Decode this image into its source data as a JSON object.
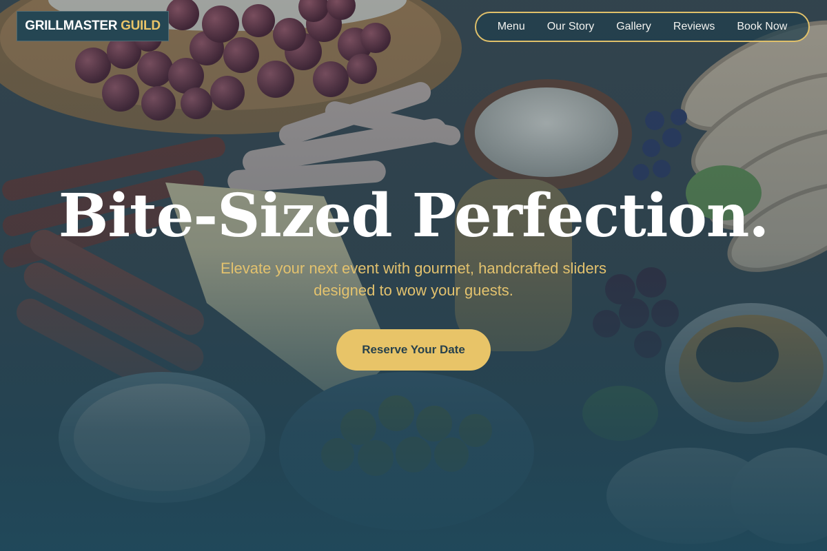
{
  "brand": {
    "name_part1": "GRILLMASTER",
    "name_part2": "GUILD"
  },
  "nav": {
    "items": [
      {
        "label": "Menu"
      },
      {
        "label": "Our Story"
      },
      {
        "label": "Gallery"
      },
      {
        "label": "Reviews"
      },
      {
        "label": "Book Now"
      }
    ]
  },
  "hero": {
    "headline": "Bite-Sized Perfection.",
    "subheadline_line1": "Elevate your next event with gourmet, handcrafted sliders",
    "subheadline_line2": "designed to wow your guests.",
    "cta_label": "Reserve Your Date",
    "image_subject": "food-platter-background"
  },
  "colors": {
    "accent_gold": "#e8c468",
    "logo_background": "#254653",
    "overlay_teal": "#204858",
    "headline_white": "#ffffff"
  }
}
